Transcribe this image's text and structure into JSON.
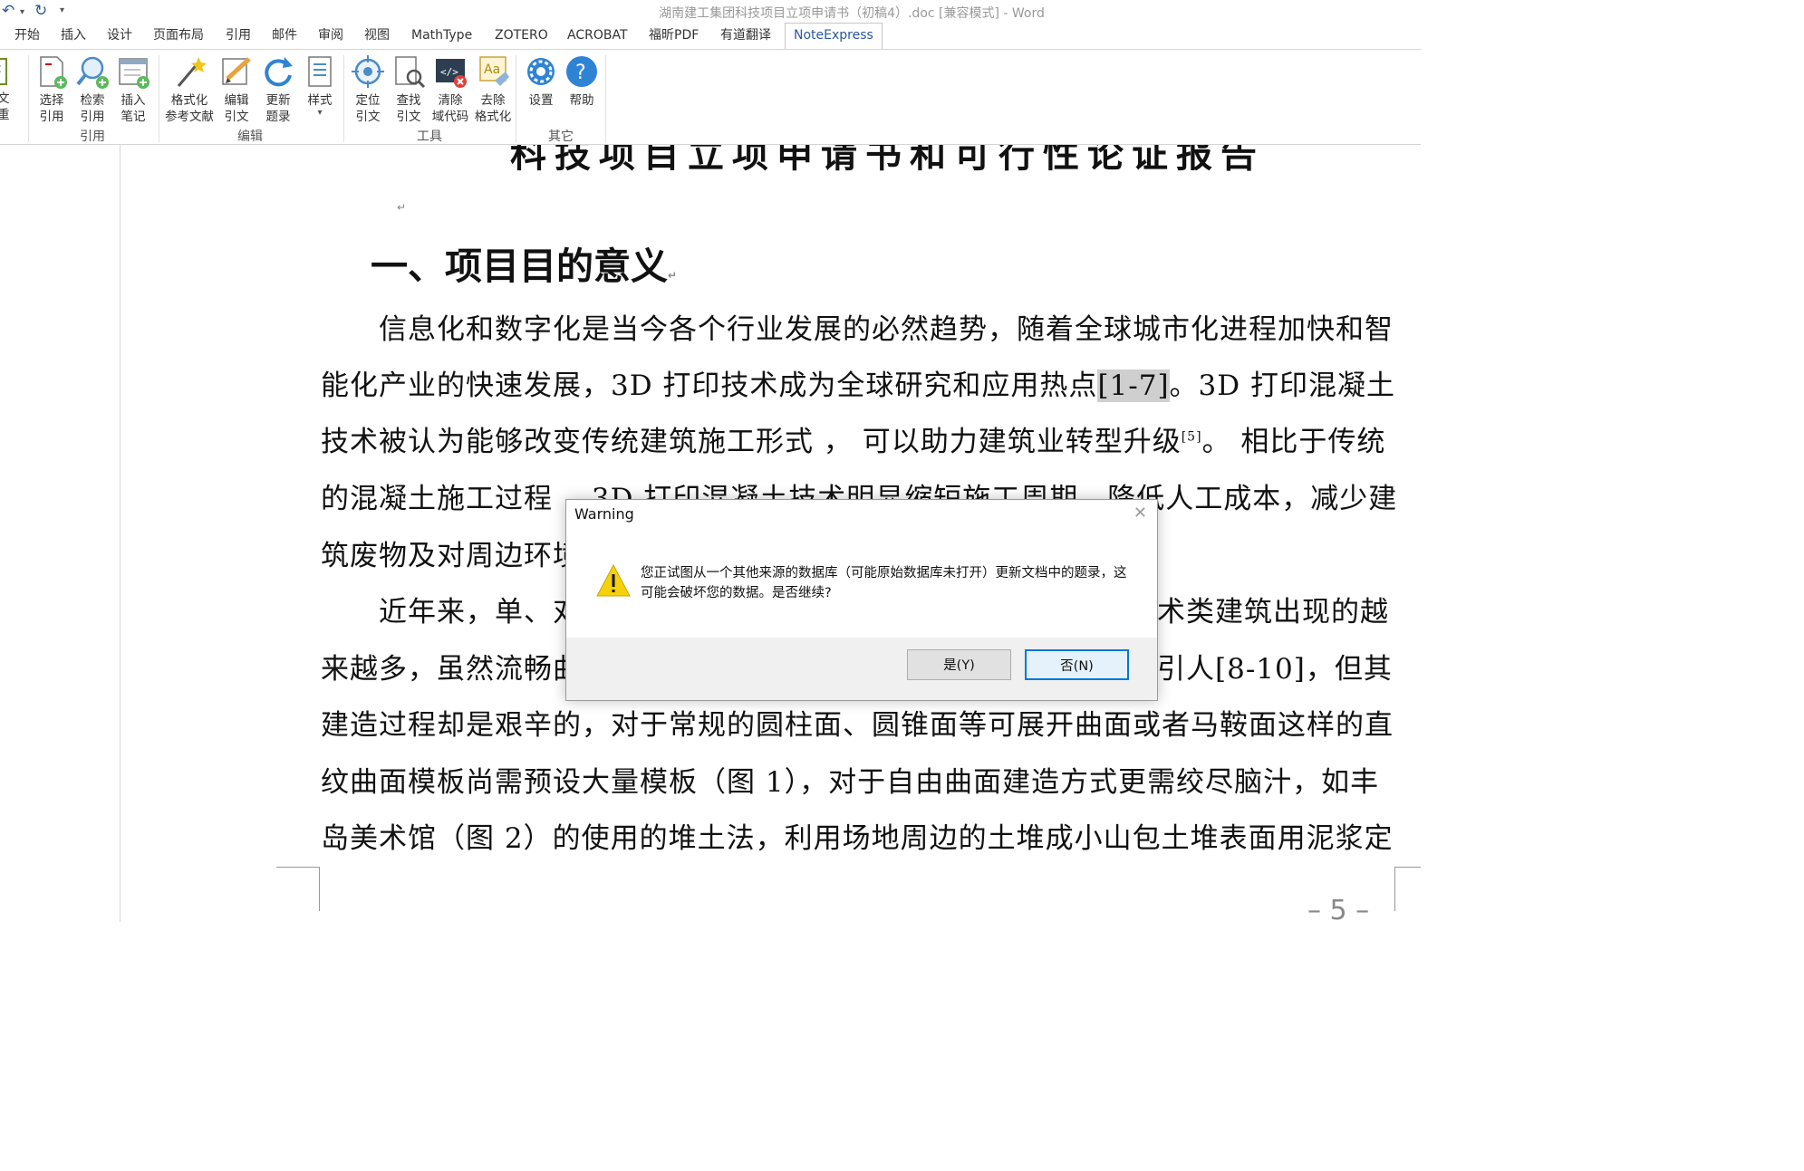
{
  "window": {
    "title": "湖南建工集团科技项目立项申请书（初稿4）.doc [兼容模式] - Word"
  },
  "quick_access": {
    "undo_icon": "undo-icon",
    "redo_icon": "redo-icon",
    "customize_icon": "customize-arrow-icon"
  },
  "menu_tabs": [
    "开始",
    "插入",
    "设计",
    "页面布局",
    "引用",
    "邮件",
    "审阅",
    "视图",
    "MathType",
    "ZOTERO",
    "ACROBAT",
    "福昕PDF",
    "有道翻译",
    "NoteExpress"
  ],
  "active_tab": "NoteExpress",
  "ribbon": {
    "partial_button": "论文\n查重",
    "groups": [
      {
        "label": "引用",
        "buttons": [
          "选择\n引用",
          "检索\n引用",
          "插入\n笔记"
        ]
      },
      {
        "label": "编辑",
        "buttons": [
          "格式化\n参考文献",
          "编辑\n引文",
          "更新\n题录",
          "样式"
        ]
      },
      {
        "label": "工具",
        "buttons": [
          "定位\n引文",
          "查找\n引文",
          "清除\n域代码",
          "去除\n格式化"
        ]
      },
      {
        "label": "其它",
        "buttons": [
          "设置",
          "帮助"
        ]
      }
    ]
  },
  "document": {
    "top_fragment": "科技项目立项申请书和可行性论证报告",
    "heading": "一、项目目的意义",
    "paragraph_mark": "↵",
    "lines": {
      "l1": "信息化和数字化是当今各个行业发展的必然趋势，随着全球城市化进程加快和智",
      "l2a": "能化产业的快速发展，3D 打印技术成为全球研究和应用热点",
      "l2b": "[1-7]",
      "l2c": "。3D 打印混凝土",
      "l3a": "技术被认为能够改变传统建筑施工形式 ， 可以助力建筑业转型升级",
      "l3b": "[5]",
      "l3c": "。 相比于传统",
      "l4": "的混凝土施工过程 ，3D 打印混凝土技术明显缩短施工周期，降低人工成本，减少建",
      "l5": "筑废物及对周边环境",
      "l6a": "近年来，单、对",
      "l6b": "术类建筑出现的越",
      "l7a": "来越多，虽然流畅曲",
      "l7b": "引人[8-10]，但其",
      "l8": "建造过程却是艰辛的，对于常规的圆柱面、圆锥面等可展开曲面或者马鞍面这样的直",
      "l9": "纹曲面模板尚需预设大量模板（图 1），对于自由曲面建造方式更需绞尽脑汁，如丰",
      "l10": "岛美术馆（图 2）的使用的堆土法，利用场地周边的土堆成小山包土堆表面用泥浆定"
    },
    "page_number": "5"
  },
  "dialog": {
    "title": "Warning",
    "message": "您正试图从一个其他来源的数据库（可能原始数据库未打开）更新文档中的题录，这可能会破坏您的数据。是否继续?",
    "yes_label": "是(Y)",
    "no_label": "否(N)",
    "icon": "warning-icon"
  },
  "colors": {
    "accent": "#2b579a",
    "dialog_focus": "#0078d7",
    "warning_yellow": "#f5d10b"
  }
}
